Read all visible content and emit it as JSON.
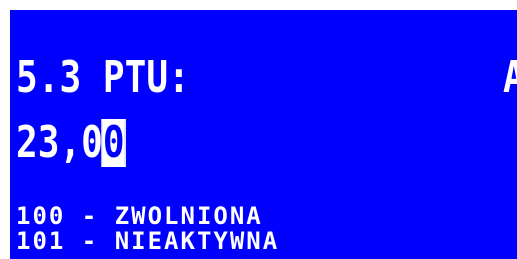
{
  "display": {
    "colors": {
      "background": "#0000ff",
      "text": "#ffffff",
      "frame": "#ffffff"
    },
    "title": "5.3 PTU:",
    "title_right": "A",
    "value": {
      "before_cursor": "23,0",
      "cursor_char": "0"
    },
    "options": [
      "100 - ZWOLNIONA",
      "101 - NIEAKTYWNA"
    ]
  }
}
